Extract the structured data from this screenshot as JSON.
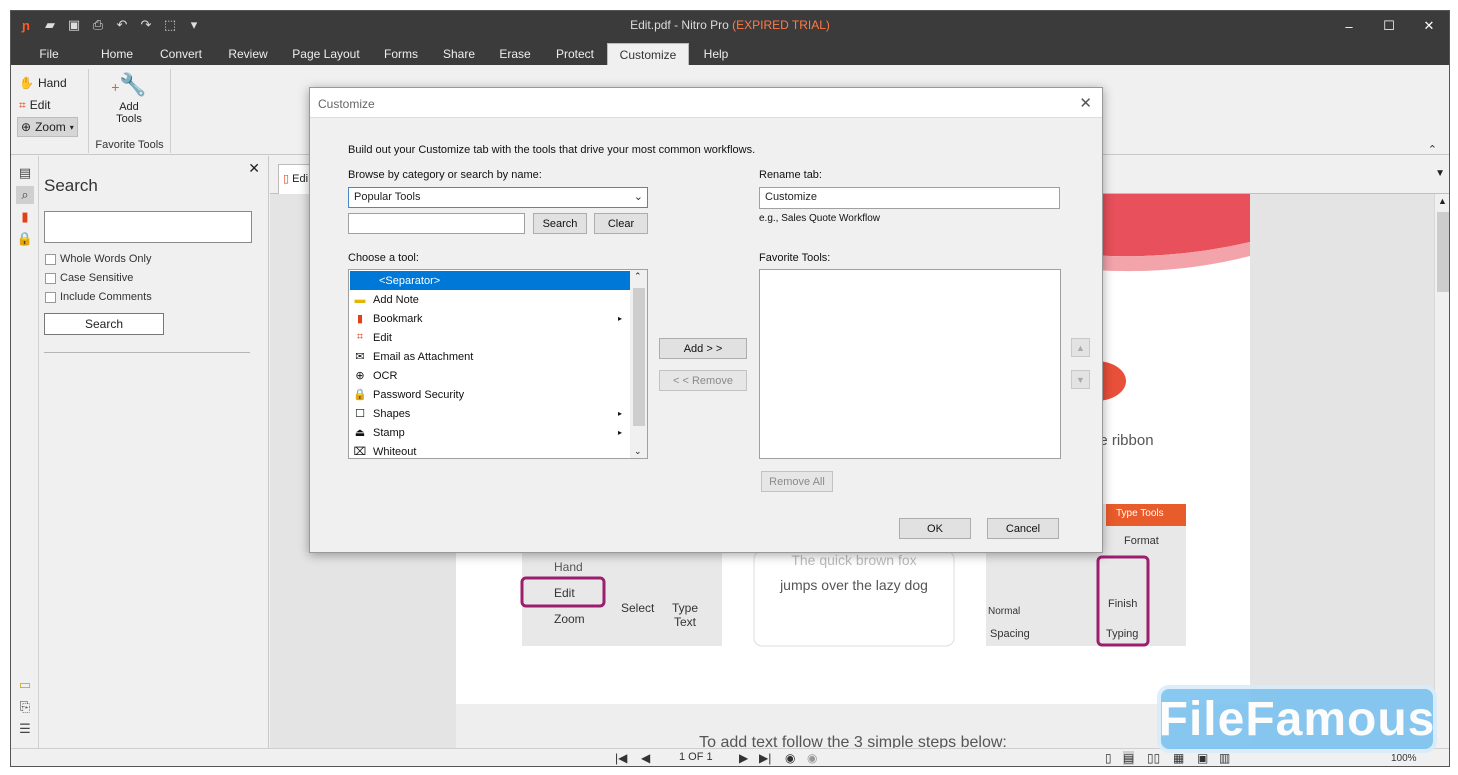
{
  "app": {
    "title_prefix": "Edit.pdf - Nitro Pro ",
    "title_trial": "(EXPIRED TRIAL)",
    "accent": "#ff7a45"
  },
  "tabs": [
    "File",
    "Home",
    "Convert",
    "Review",
    "Page Layout",
    "Forms",
    "Share",
    "Erase",
    "Protect",
    "Customize",
    "Help"
  ],
  "active_tab": "Customize",
  "ribbon": {
    "hand": "Hand",
    "edit": "Edit",
    "zoom": "Zoom",
    "add_tools_1": "Add",
    "add_tools_2": "Tools",
    "group_label": "Favorite Tools"
  },
  "search_panel": {
    "title": "Search",
    "options": [
      "Whole Words Only",
      "Case Sensitive",
      "Include Comments"
    ],
    "button": "Search"
  },
  "doc": {
    "tab_label": "Edi",
    "text_fragments": {
      "ribbon": "he ribbon",
      "quick": "The quick brown fox",
      "jumps": "jumps over the lazy dog",
      "steps": "To add text follow the 3 simple steps below:",
      "type_tools": "Type Tools",
      "format": "Format",
      "hand": "Hand",
      "edit": "Edit",
      "zoom": "Zoom",
      "select": "Select",
      "type": "Type",
      "text": "Text",
      "normal": "Normal",
      "spacing": "Spacing",
      "finish": "Finish",
      "typing": "Typing"
    }
  },
  "statusbar": {
    "page": "1 OF 1",
    "zoom": "100%"
  },
  "dialog": {
    "title": "Customize",
    "intro": "Build out your Customize tab with the tools that drive your most common workflows.",
    "browse_label": "Browse by category or search by name:",
    "category": "Popular Tools",
    "search_btn": "Search",
    "clear_btn": "Clear",
    "choose_label": "Choose a tool:",
    "tools": [
      {
        "label": "<Separator>",
        "icon": "none",
        "submenu": false,
        "selected": true
      },
      {
        "label": "Add Note",
        "icon": "note-icon",
        "submenu": false
      },
      {
        "label": "Bookmark",
        "icon": "bookmark-icon",
        "submenu": true
      },
      {
        "label": "Edit",
        "icon": "edit-icon",
        "submenu": false
      },
      {
        "label": "Email as Attachment",
        "icon": "email-icon",
        "submenu": false
      },
      {
        "label": "OCR",
        "icon": "ocr-icon",
        "submenu": false
      },
      {
        "label": "Password Security",
        "icon": "lock-icon",
        "submenu": false
      },
      {
        "label": "Shapes",
        "icon": "shapes-icon",
        "submenu": true
      },
      {
        "label": "Stamp",
        "icon": "stamp-icon",
        "submenu": true
      },
      {
        "label": "Whiteout",
        "icon": "whiteout-icon",
        "submenu": false
      }
    ],
    "add_btn": "Add > >",
    "remove_btn": "< < Remove",
    "rename_label": "Rename tab:",
    "rename_value": "Customize",
    "rename_hint": "e.g., Sales Quote Workflow",
    "favorites_label": "Favorite Tools:",
    "remove_all_btn": "Remove All",
    "ok_btn": "OK",
    "cancel_btn": "Cancel"
  },
  "watermark": "FileFamous"
}
